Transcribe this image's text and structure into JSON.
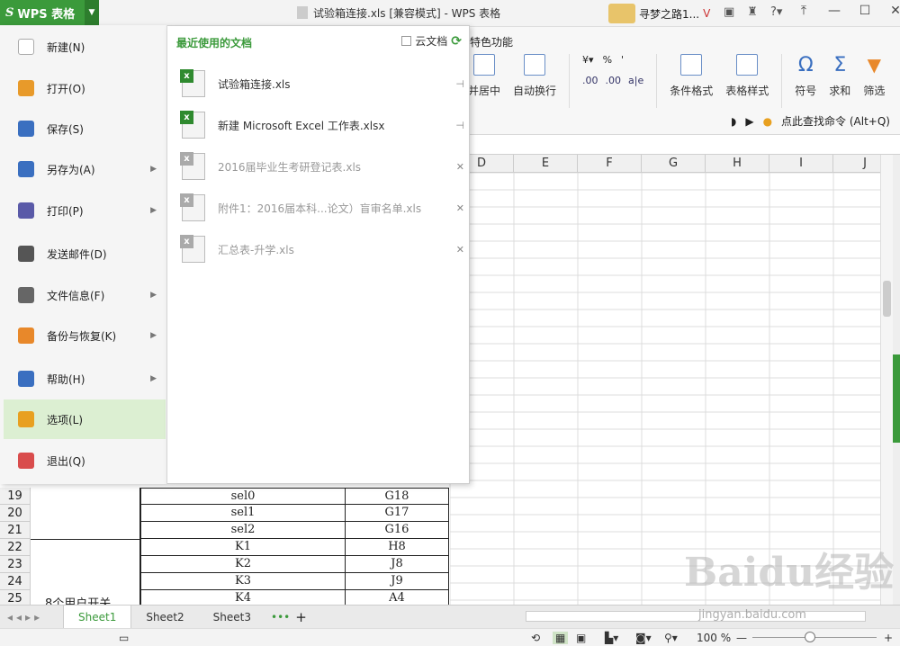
{
  "app": {
    "brand": "WPS 表格",
    "window_title": "试验箱连接.xls [兼容模式] - WPS 表格",
    "user_name": "寻梦之路1..."
  },
  "ribbon": {
    "tab_special": "特色功能",
    "merge_center": "并居中",
    "wrap_text": "自动换行",
    "percent": "%",
    "comma": "'",
    "cond_format": "条件格式",
    "table_style": "表格样式",
    "symbol": "符号",
    "sum": "求和",
    "filter": "筛选",
    "find_command": "点此查找命令 (Alt+Q)"
  },
  "menu": {
    "items": [
      {
        "label": "新建(N)",
        "arrow": false
      },
      {
        "label": "打开(O)",
        "arrow": false
      },
      {
        "label": "保存(S)",
        "arrow": false
      },
      {
        "label": "另存为(A)",
        "arrow": true
      },
      {
        "label": "打印(P)",
        "arrow": true
      },
      {
        "label": "发送邮件(D)",
        "arrow": false
      },
      {
        "label": "文件信息(F)",
        "arrow": true
      },
      {
        "label": "备份与恢复(K)",
        "arrow": true
      },
      {
        "label": "帮助(H)",
        "arrow": true
      },
      {
        "label": "选项(L)",
        "arrow": false
      },
      {
        "label": "退出(Q)",
        "arrow": false
      }
    ]
  },
  "recent": {
    "header": "最近使用的文档",
    "cloud_label": "云文档",
    "docs": [
      {
        "name": "试验箱连接.xls",
        "pinned": true
      },
      {
        "name": "新建 Microsoft Excel 工作表.xlsx",
        "pinned": true
      },
      {
        "name": "2016届毕业生考研登记表.xls",
        "pinned": false
      },
      {
        "name": "附件1：2016届本科...论文）盲审名单.xls",
        "pinned": false
      },
      {
        "name": "汇总表-升学.xls",
        "pinned": false
      }
    ]
  },
  "columns": [
    "D",
    "E",
    "F",
    "G",
    "H",
    "I",
    "J"
  ],
  "rows": {
    "numbers": [
      "19",
      "20",
      "21",
      "22",
      "23",
      "24",
      "25"
    ],
    "b": [
      "sel0",
      "sel1",
      "sel2",
      "K1",
      "K2",
      "K3",
      "K4"
    ],
    "c": [
      "G18",
      "G17",
      "G16",
      "H8",
      "J8",
      "J9",
      "A4"
    ],
    "a_text": "8个用户开关"
  },
  "sheets": [
    "Sheet1",
    "Sheet2",
    "Sheet3"
  ],
  "status": {
    "zoom": "100 %"
  },
  "watermark": {
    "brand": "Baidu经验",
    "url": "jingyan.baidu.com"
  }
}
